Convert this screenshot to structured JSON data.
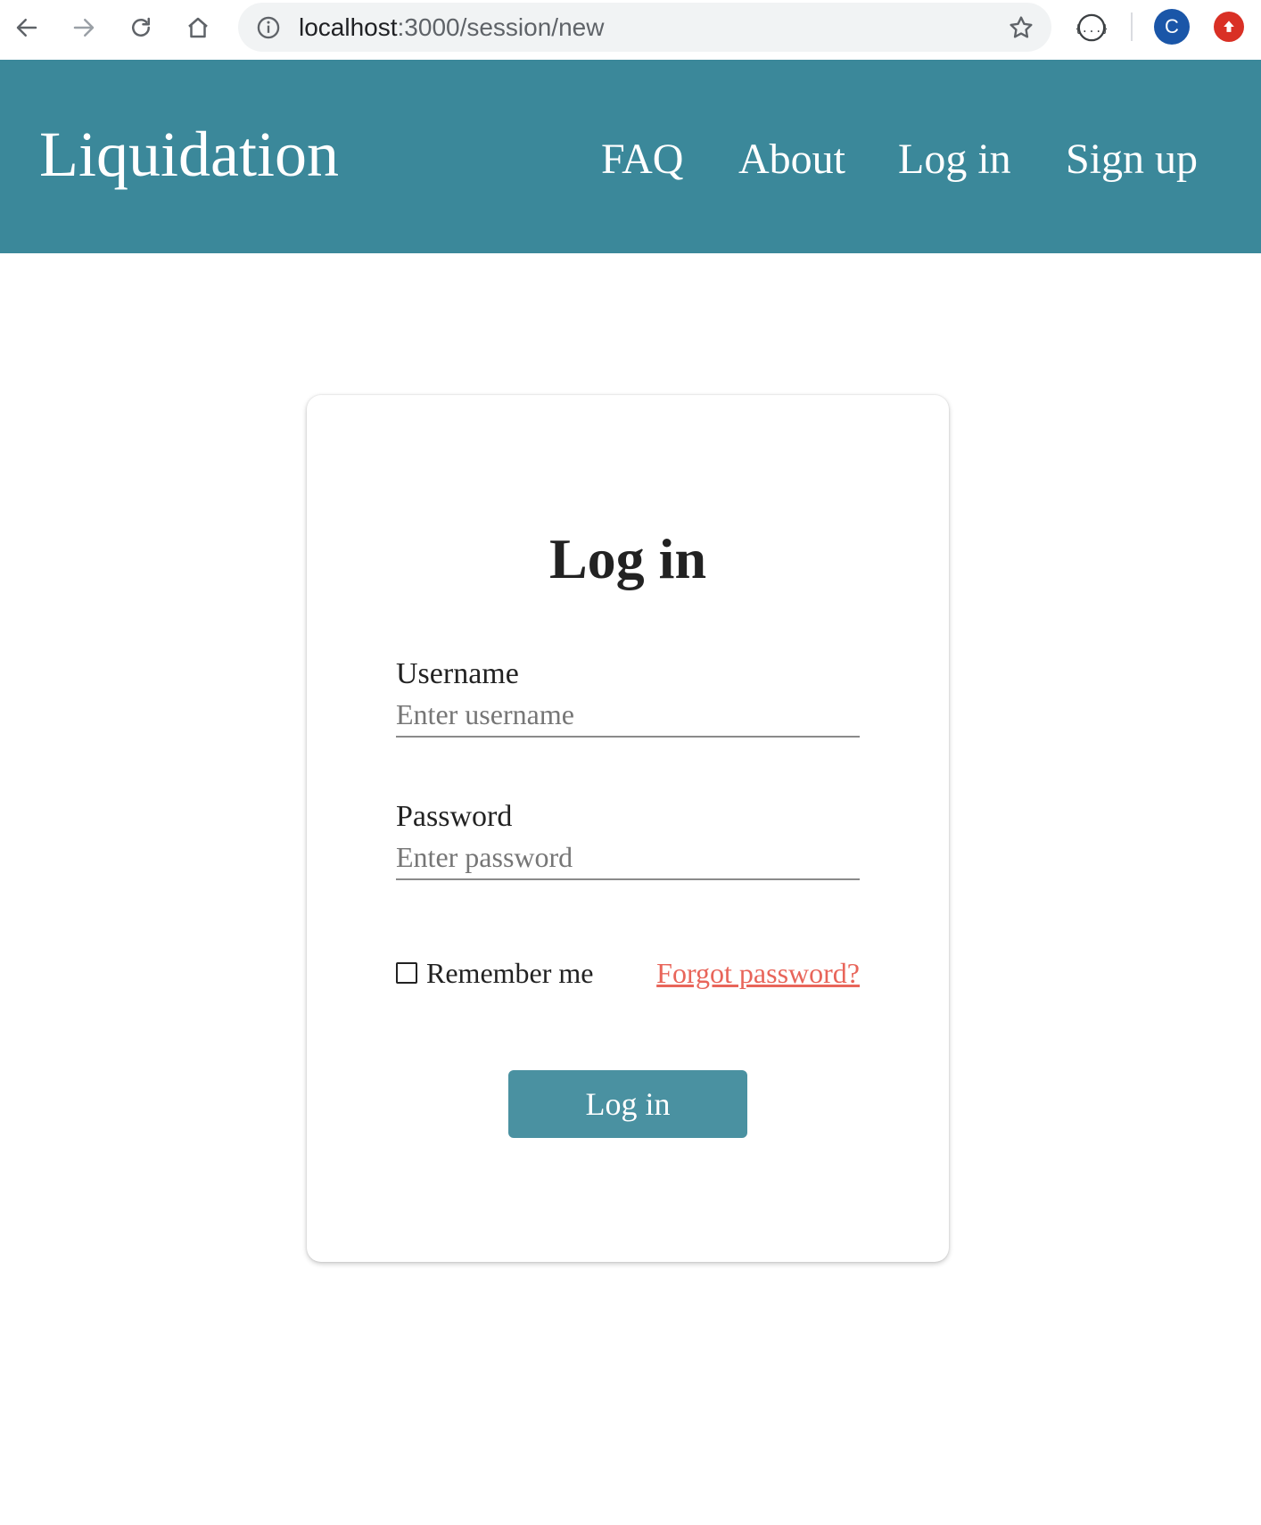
{
  "browser": {
    "url_host": "localhost",
    "url_path": ":3000/session/new",
    "profile_initial": "C",
    "icons": [
      "back-icon",
      "forward-icon",
      "reload-icon",
      "home-icon",
      "info-icon",
      "star-icon",
      "extension-icon",
      "update-icon"
    ]
  },
  "header": {
    "brand": "Liquidation",
    "nav": {
      "faq": "FAQ",
      "about": "About",
      "login": "Log in",
      "signup": "Sign up"
    },
    "background_color": "#3b889a"
  },
  "login": {
    "title": "Log in",
    "username_label": "Username",
    "username_placeholder": "Enter username",
    "password_label": "Password",
    "password_placeholder": "Enter password",
    "remember_label": "Remember me",
    "forgot_link": "Forgot password?",
    "submit_label": "Log in",
    "link_color": "#e8655a",
    "button_color": "#4a91a1"
  }
}
